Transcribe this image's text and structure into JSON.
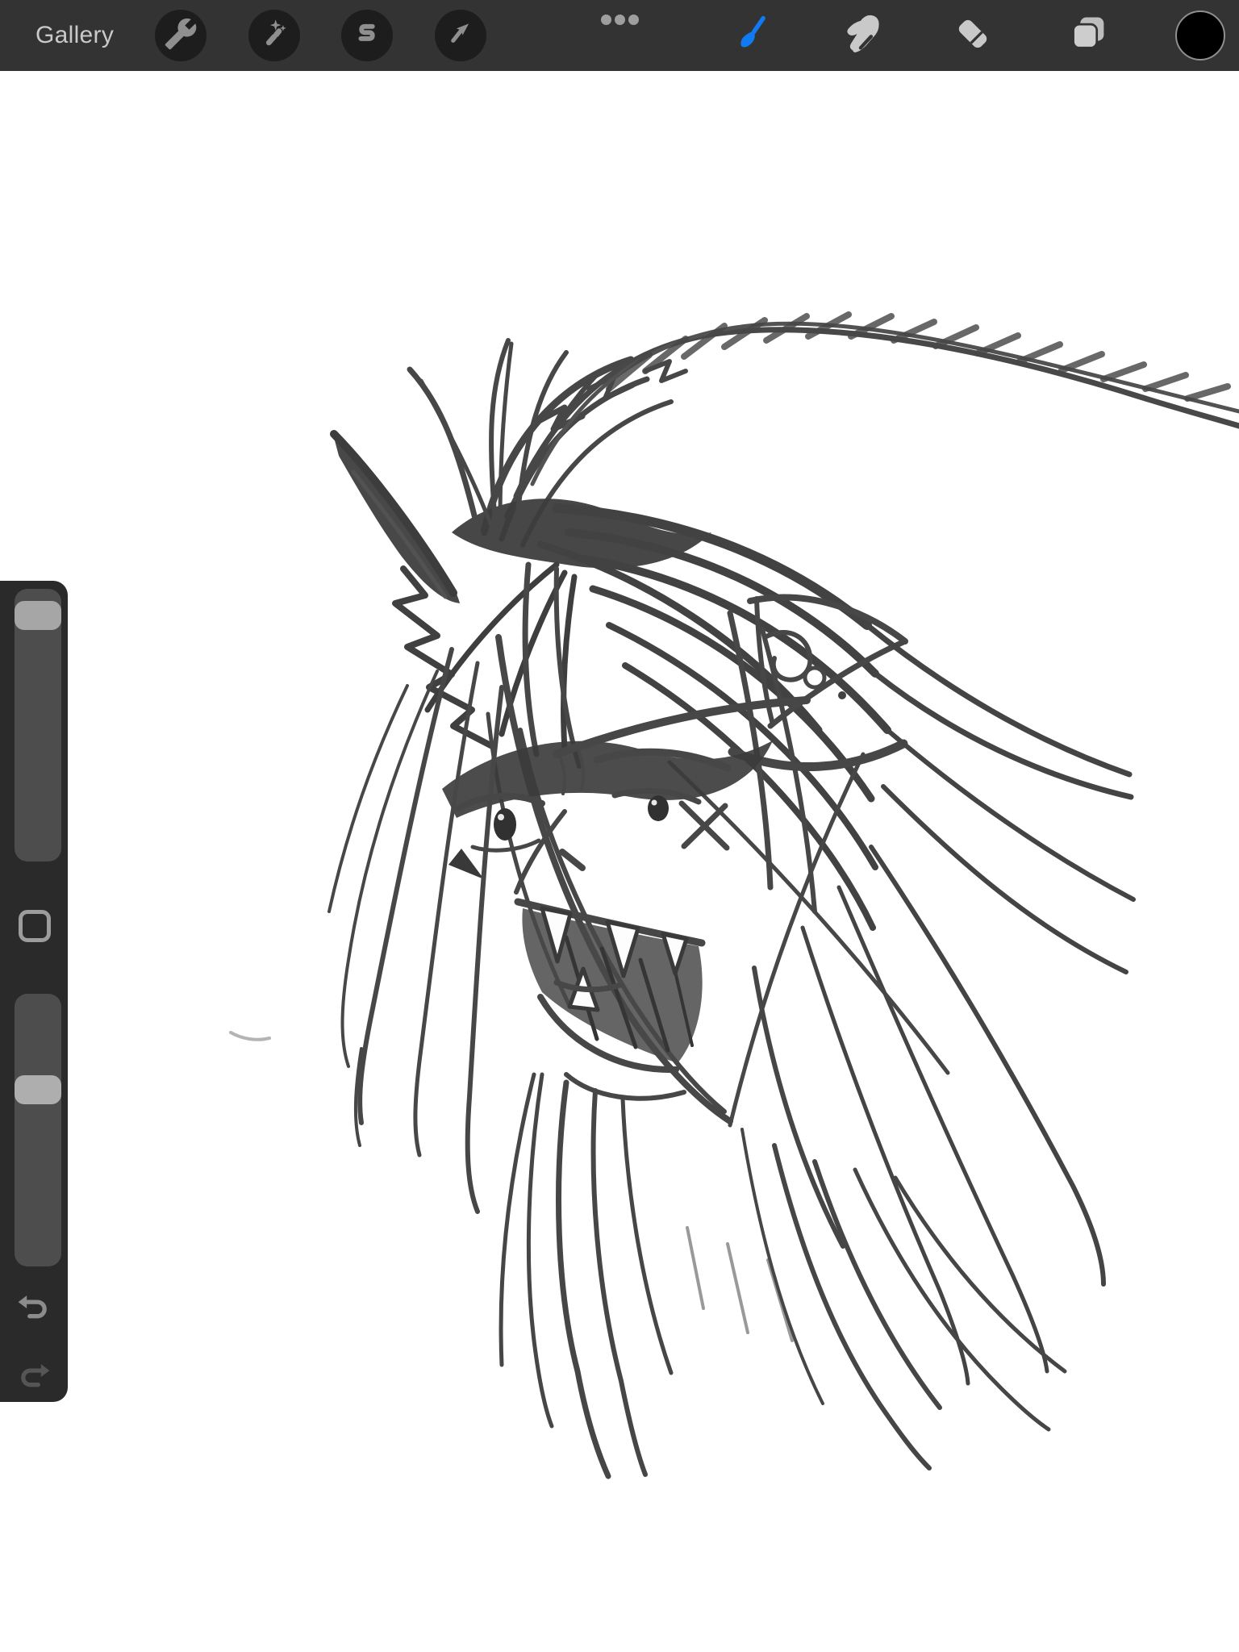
{
  "colors": {
    "toolbar_bg": "#333333",
    "toolbar_button_bg": "#1D1D1D",
    "icon_muted": "#8F8F8F",
    "icon_light": "#C9C9C9",
    "accent_blue": "#1179F2",
    "gallery_text": "#C9C9C9",
    "sidebar_bg": "#2A2A2A",
    "slider_track": "#4D4D4D",
    "slider_handle": "#A6A6A6",
    "modify_outline": "#9C9C9C",
    "undo_icon": "#8C8C8C",
    "redo_icon": "#555555",
    "color_swatch_value": "#000000",
    "canvas_bg": "#FFFFFF",
    "sketch_ink": "#333333"
  },
  "toolbar": {
    "gallery_label": "Gallery",
    "left_buttons": [
      {
        "label": "actions",
        "icon": "wrench-icon"
      },
      {
        "label": "adjustments",
        "icon": "magic-wand-icon"
      },
      {
        "label": "selection",
        "icon": "selection-s-icon"
      },
      {
        "label": "transform",
        "icon": "transform-arrow-icon"
      }
    ],
    "canvas_options": {
      "icon": "ellipsis-icon",
      "dot_count": 3
    },
    "right_tools": [
      {
        "label": "paint",
        "icon": "paintbrush-icon",
        "selected": true,
        "color": "#1179F2"
      },
      {
        "label": "smudge",
        "icon": "smudge-finger-icon",
        "selected": false
      },
      {
        "label": "erase",
        "icon": "eraser-icon",
        "selected": false
      },
      {
        "label": "layers",
        "icon": "layers-icon",
        "selected": false
      },
      {
        "label": "color",
        "icon": "color-swatch",
        "value": "#000000"
      }
    ]
  },
  "sidebar": {
    "brush_size_slider": {
      "name": "brush-size",
      "handle_position_pct": 9
    },
    "modify_button": {
      "icon": "square-icon"
    },
    "opacity_slider": {
      "name": "brush-opacity",
      "handle_position_pct": 35
    },
    "undo": {
      "icon": "undo-icon",
      "enabled": true
    },
    "redo": {
      "icon": "redo-icon",
      "enabled": false
    }
  },
  "canvas": {
    "description": "Graphite-style digital sketch of a snarling unicorn head: jagged dark horn at upper left, long feathered plume sweeping off the upper right edge, pointed ear with swirl doodles, furrowed brows over fierce eyes, open fanged mouth, and a wild mane of long flowing strands on a white canvas."
  }
}
